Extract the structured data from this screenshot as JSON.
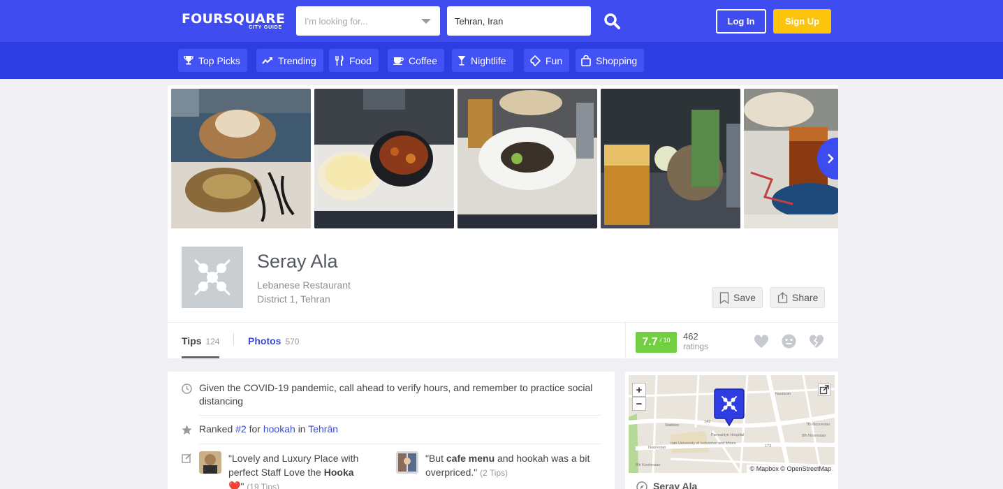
{
  "header": {
    "logo": "FOURSQUARE",
    "logo_sub": "CITY GUIDE",
    "search_placeholder": "I'm looking for...",
    "location_value": "Tehran, Iran",
    "login_label": "Log In",
    "signup_label": "Sign Up",
    "accent": "#3f4cef",
    "signup_color": "#fcc40a"
  },
  "categories": [
    {
      "label": "Top Picks",
      "icon": "trophy-icon"
    },
    {
      "label": "Trending",
      "icon": "trending-icon"
    },
    {
      "label": "Food",
      "icon": "fork-knife-icon"
    },
    {
      "label": "Coffee",
      "icon": "coffee-cup-icon"
    },
    {
      "label": "Nightlife",
      "icon": "cocktail-icon"
    },
    {
      "label": "Fun",
      "icon": "ticket-icon"
    },
    {
      "label": "Shopping",
      "icon": "shopping-bag-icon"
    }
  ],
  "venue": {
    "name": "Seray Ala",
    "category": "Lebanese Restaurant",
    "location": "District 1, Tehran",
    "save_label": "Save",
    "share_label": "Share",
    "tabs": [
      {
        "label": "Tips",
        "count": "124"
      },
      {
        "label": "Photos",
        "count": "570"
      }
    ],
    "score": "7.7",
    "score_max": "/ 10",
    "score_color": "#73cf42",
    "ratings_count": "462",
    "ratings_label": "ratings"
  },
  "tips": {
    "covid_notice": "Given the COVID-19 pandemic, call ahead to verify hours, and remember to practice social distancing",
    "rank_prefix": "Ranked",
    "rank_number": "#2",
    "rank_for": "for",
    "rank_topic": "hookah",
    "rank_in": "in",
    "rank_city": "Tehrān",
    "quote1_start": "\"Lovely and Luxury Place with perfect Staff Love the",
    "quote1_bold": "Hooka",
    "quote1_end": "\"",
    "quote1_meta": "(19 Tips)",
    "quote2_start": "\"But",
    "quote2_bold": "cafe menu",
    "quote2_end": "and hookah was a bit overpriced.\"",
    "quote2_meta": "(2 Tips)"
  },
  "map": {
    "zoom_in": "+",
    "zoom_out": "−",
    "attribution": "© Mapbox © OpenStreetMap",
    "labels": [
      "Stabboo",
      "142",
      "Farmaniye Hospital",
      "Iran University of Industries and Mines",
      "7th Noorestan",
      "8th Noorestan",
      "Noorestan",
      "173",
      "8th Koohestan",
      "Nastaran"
    ],
    "venue_name": "Seray Ala"
  }
}
